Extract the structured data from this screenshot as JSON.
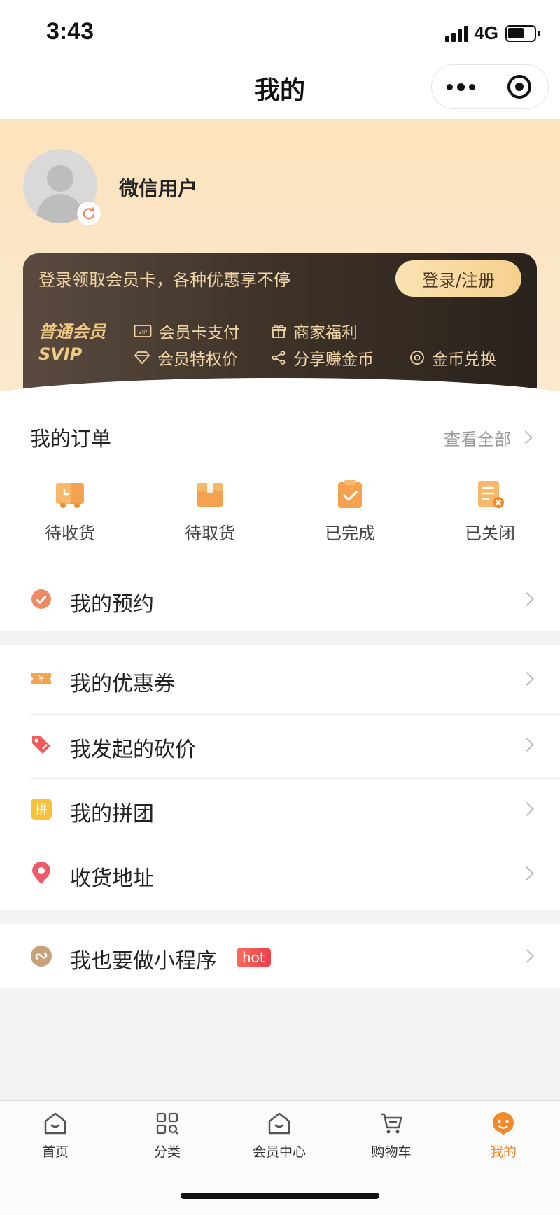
{
  "status_bar": {
    "time": "3:43",
    "network": "4G"
  },
  "nav": {
    "title": "我的"
  },
  "profile": {
    "username": "微信用户"
  },
  "member_card": {
    "tip": "登录领取会员卡，各种优惠享不停",
    "login_label": "登录/注册",
    "level_name": "普通会员",
    "level_svip": "SVIP",
    "perks": {
      "card_pay": "会员卡支付",
      "merchant_benefits": "商家福利",
      "privileges": "会员特权价",
      "share_earn": "分享赚金币",
      "coin_exchange": "金币兑换"
    }
  },
  "orders": {
    "title": "我的订单",
    "view_all": "查看全部",
    "items": [
      {
        "label": "待收货",
        "icon": "delivery-truck-icon"
      },
      {
        "label": "待取货",
        "icon": "package-box-icon"
      },
      {
        "label": "已完成",
        "icon": "clipboard-check-icon"
      },
      {
        "label": "已关闭",
        "icon": "document-closed-icon"
      }
    ]
  },
  "menu": {
    "appointment": "我的预约",
    "coupons": "我的优惠券",
    "bargain": "我发起的砍价",
    "group_buy": "我的拼团",
    "address": "收货地址",
    "mini_program": "我也要做小程序",
    "hot_badge": "hot"
  },
  "tabbar": {
    "items": [
      {
        "label": "首页",
        "icon": "home-icon"
      },
      {
        "label": "分类",
        "icon": "category-grid-icon"
      },
      {
        "label": "会员中心",
        "icon": "member-center-icon"
      },
      {
        "label": "购物车",
        "icon": "cart-icon"
      },
      {
        "label": "我的",
        "icon": "profile-face-icon",
        "active": true
      }
    ]
  },
  "colors": {
    "accent": "#f08a2a",
    "header_bg": "#fde3bd",
    "card_bg": "#403429",
    "card_text": "#f2d6a8",
    "level_text": "#f0c985"
  }
}
